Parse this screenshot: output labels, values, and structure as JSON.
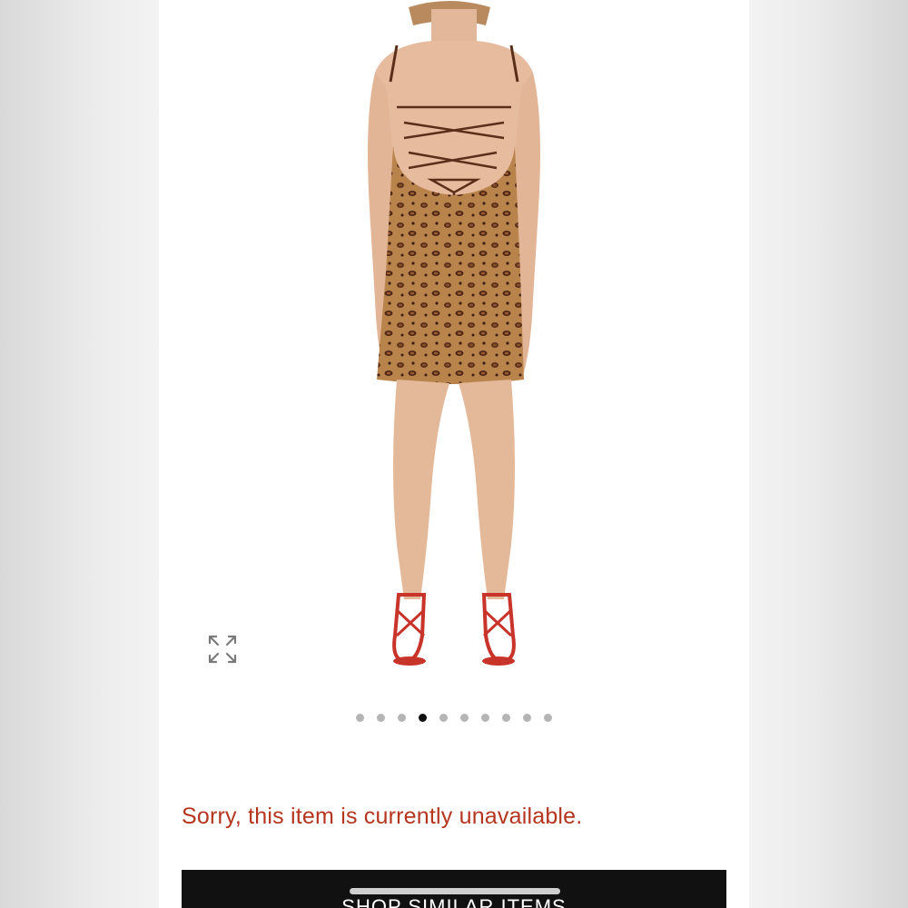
{
  "product": {
    "image_icon": "model-in-leopard-print-dress-photo",
    "expand_icon": "expand-arrows-icon"
  },
  "carousel": {
    "total": 10,
    "active_index": 3
  },
  "status": {
    "message": "Sorry, this item is currently unavailable."
  },
  "actions": {
    "shop_similar_label": "SHOP SIMILAR ITEMS"
  },
  "colors": {
    "message": "#b5351f",
    "button_bg": "#111111",
    "dot_active": "#111111",
    "dot_inactive": "#b5b5b5"
  }
}
